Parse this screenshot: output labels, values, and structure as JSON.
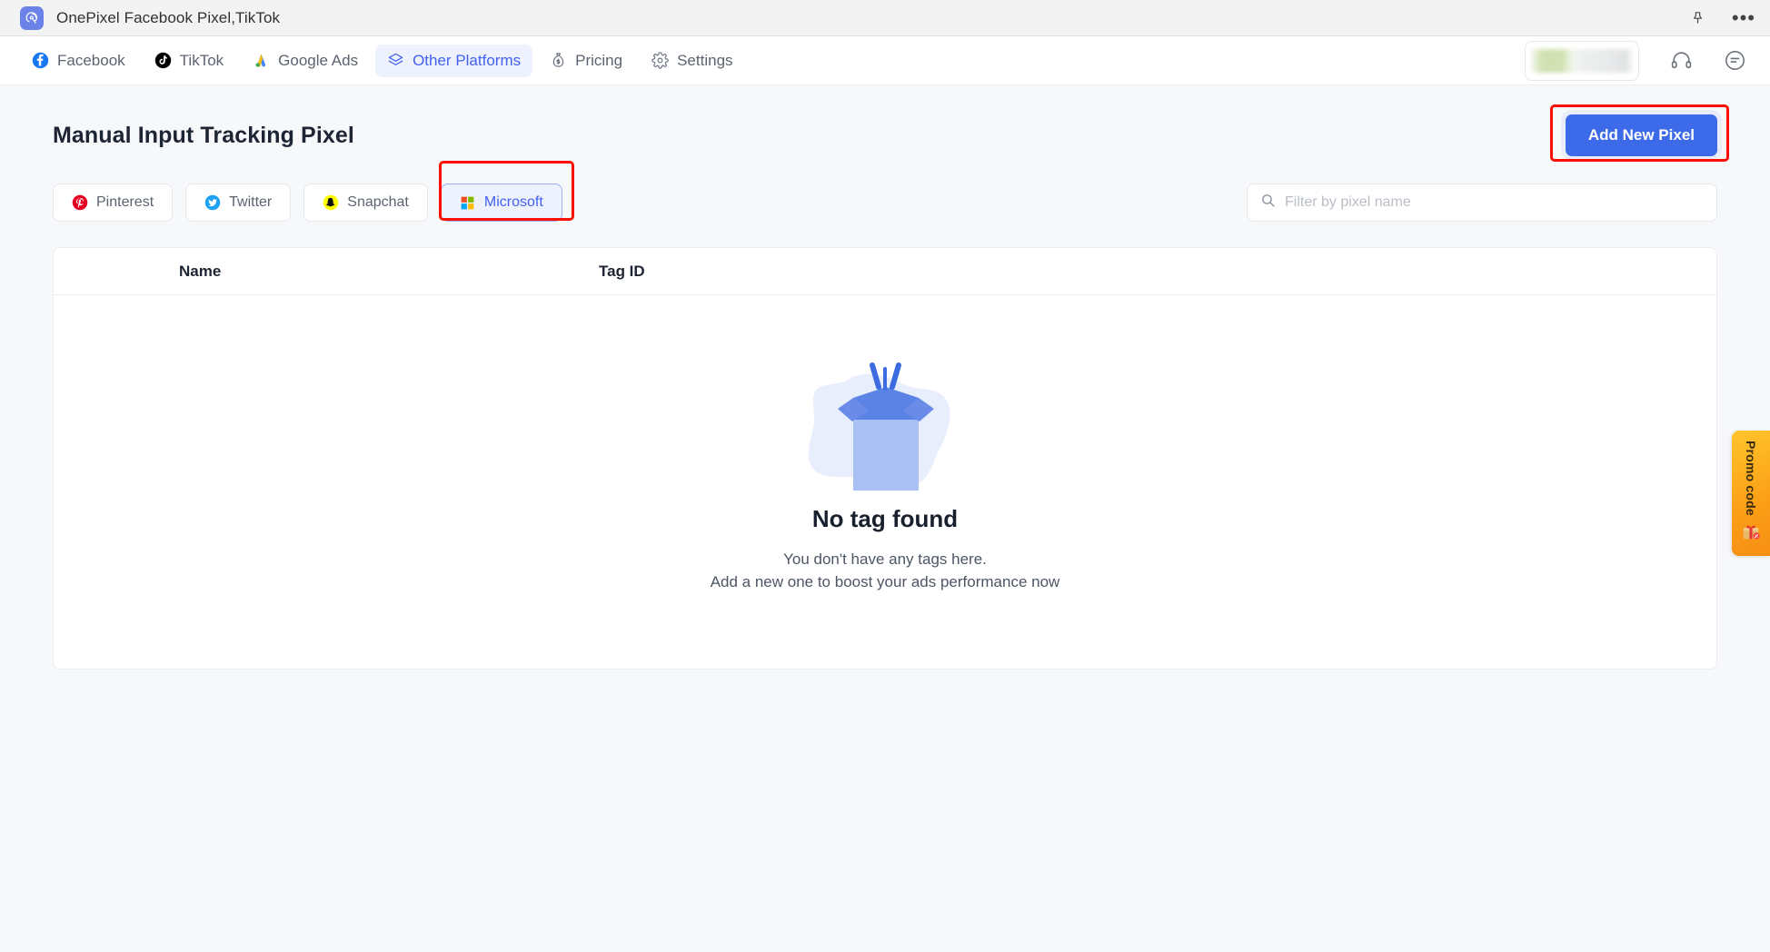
{
  "titlebar": {
    "app_name": "OnePixel Facebook Pixel,TikTok",
    "icon": "onepixel-logo",
    "actions": [
      {
        "name": "pin-icon",
        "label": ""
      },
      {
        "name": "more-options-icon",
        "label": "•••"
      }
    ]
  },
  "nav": {
    "items": [
      {
        "label": "Facebook",
        "icon": "facebook-icon",
        "active": false
      },
      {
        "label": "TikTok",
        "icon": "tiktok-icon",
        "active": false
      },
      {
        "label": "Google Ads",
        "icon": "google-ads-icon",
        "active": false
      },
      {
        "label": "Other Platforms",
        "icon": "layers-icon",
        "active": true
      },
      {
        "label": "Pricing",
        "icon": "money-bag-icon",
        "active": false
      },
      {
        "label": "Settings",
        "icon": "gear-icon",
        "active": false
      }
    ],
    "right": {
      "account_pill": "",
      "support_icon": "headset-icon",
      "chat_icon": "message-icon"
    },
    "active_color": "#4361ee",
    "active_bg": "#eef1fe"
  },
  "page": {
    "title": "Manual Input Tracking Pixel",
    "add_button": "Add New Pixel",
    "accent_color": "#3d6ae8",
    "highlight_color": "#fa0f00"
  },
  "chips": [
    {
      "label": "Pinterest",
      "icon": "pinterest-icon",
      "selected": false
    },
    {
      "label": "Twitter",
      "icon": "twitter-icon",
      "selected": false
    },
    {
      "label": "Snapchat",
      "icon": "snapchat-icon",
      "selected": false
    },
    {
      "label": "Microsoft",
      "icon": "microsoft-icon",
      "selected": true
    }
  ],
  "search": {
    "placeholder": "Filter by pixel name",
    "value": "",
    "icon": "search-icon"
  },
  "table": {
    "columns": [
      "Name",
      "Tag ID"
    ],
    "rows": []
  },
  "empty_state": {
    "illustration": "open-box-icon",
    "title": "No tag found",
    "line1": "You don't have any tags here.",
    "line2": "Add a new one to boost your ads performance now"
  },
  "promo": {
    "label": "Promo code",
    "icon": "gift-icon"
  }
}
